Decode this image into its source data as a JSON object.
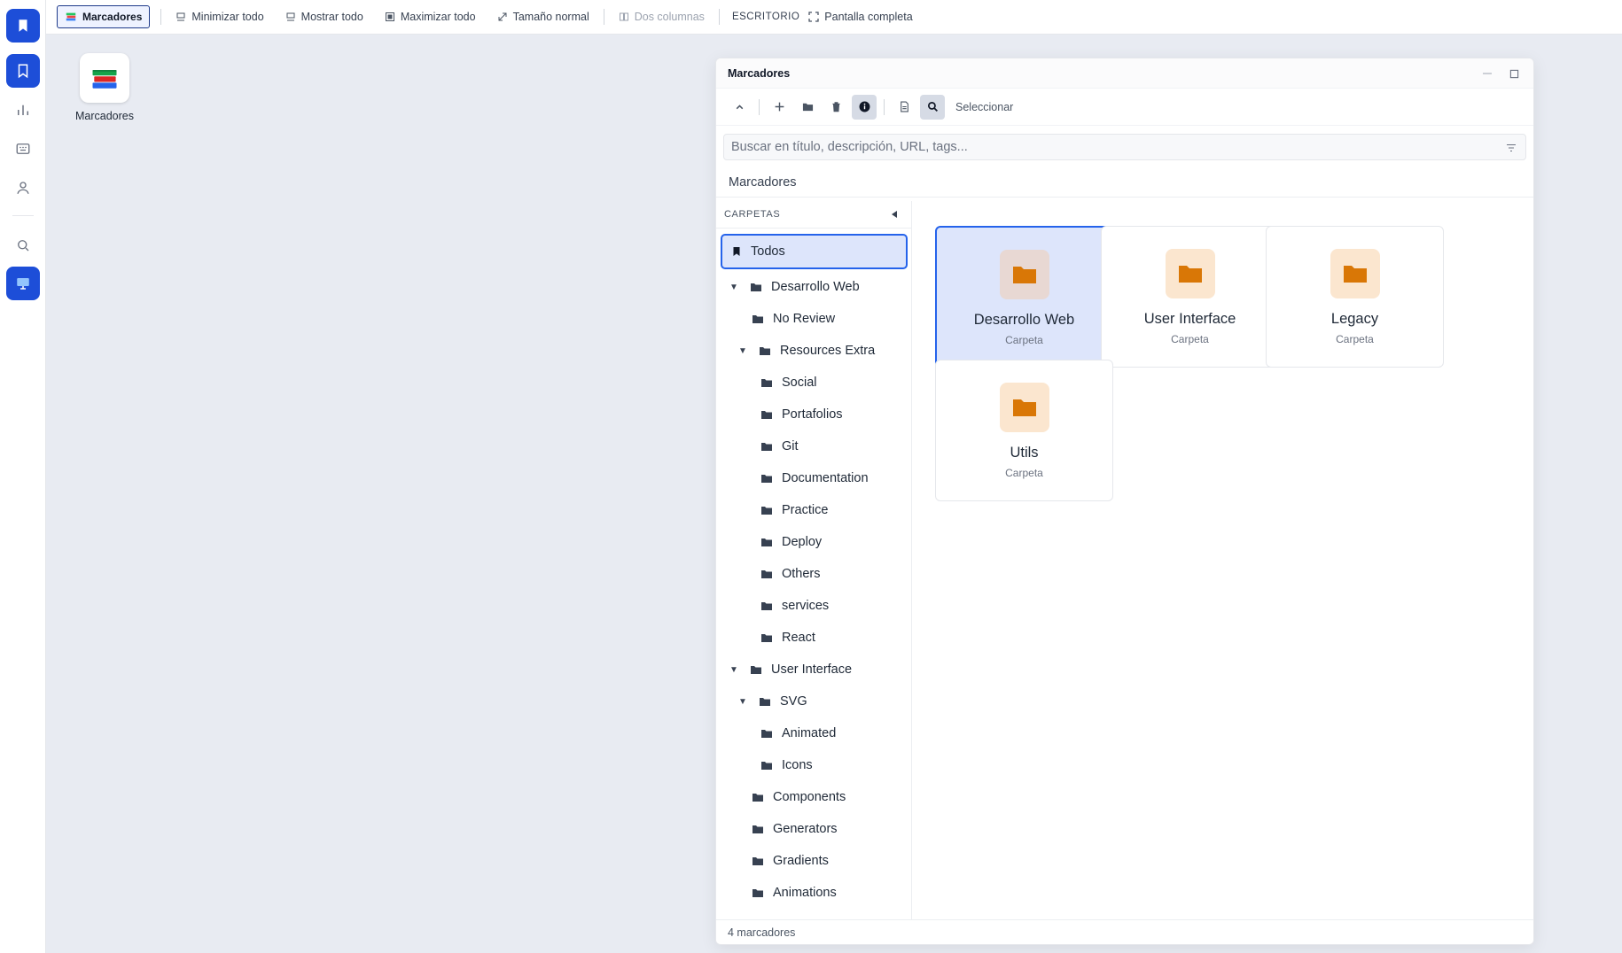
{
  "rail": {
    "items": [
      {
        "icon": "bookmark-icon",
        "active": true
      },
      {
        "icon": "bookmark-outline-icon",
        "active": true
      },
      {
        "icon": "bar-chart-icon",
        "active": false
      },
      {
        "icon": "keyboard-icon",
        "active": false
      },
      {
        "icon": "user-icon",
        "active": false
      },
      {
        "icon": "search-icon",
        "active": false
      },
      {
        "icon": "monitor-icon",
        "active": true
      }
    ]
  },
  "topbar": {
    "app_label": "Marcadores",
    "minimize_all": "Minimizar todo",
    "show_all": "Mostrar todo",
    "maximize_all": "Maximizar todo",
    "normal_size": "Tamaño normal",
    "two_columns": "Dos columnas",
    "desktop_label": "ESCRITORIO",
    "fullscreen": "Pantalla completa"
  },
  "desktop": {
    "icon_label": "Marcadores"
  },
  "window": {
    "title": "Marcadores",
    "toolbar": {
      "select_label": "Seleccionar"
    },
    "search": {
      "placeholder": "Buscar en título, descripción, URL, tags..."
    },
    "breadcrumb": "Marcadores",
    "sidebar": {
      "header": "CARPETAS",
      "tree": [
        {
          "label": "Todos",
          "depth": 0,
          "type": "all",
          "selected": true
        },
        {
          "label": "Desarrollo Web",
          "depth": 0,
          "type": "folder",
          "expanded": true
        },
        {
          "label": "No Review",
          "depth": 1,
          "type": "folder"
        },
        {
          "label": "Resources Extra",
          "depth": 1,
          "type": "folder",
          "expanded": true
        },
        {
          "label": "Social",
          "depth": 2,
          "type": "folder"
        },
        {
          "label": "Portafolios",
          "depth": 2,
          "type": "folder"
        },
        {
          "label": "Git",
          "depth": 2,
          "type": "folder"
        },
        {
          "label": "Documentation",
          "depth": 2,
          "type": "folder"
        },
        {
          "label": "Practice",
          "depth": 2,
          "type": "folder"
        },
        {
          "label": "Deploy",
          "depth": 2,
          "type": "folder"
        },
        {
          "label": "Others",
          "depth": 2,
          "type": "folder"
        },
        {
          "label": "services",
          "depth": 2,
          "type": "folder"
        },
        {
          "label": "React",
          "depth": 2,
          "type": "folder"
        },
        {
          "label": "User Interface",
          "depth": 0,
          "type": "folder",
          "expanded": true
        },
        {
          "label": "SVG",
          "depth": 1,
          "type": "folder",
          "expanded": true
        },
        {
          "label": "Animated",
          "depth": 2,
          "type": "folder"
        },
        {
          "label": "Icons",
          "depth": 2,
          "type": "folder"
        },
        {
          "label": "Components",
          "depth": 1,
          "type": "folder"
        },
        {
          "label": "Generators",
          "depth": 1,
          "type": "folder"
        },
        {
          "label": "Gradients",
          "depth": 1,
          "type": "folder"
        },
        {
          "label": "Animations",
          "depth": 1,
          "type": "folder"
        }
      ]
    },
    "cards": [
      {
        "name": "Desarrollo Web",
        "type": "Carpeta",
        "selected": true
      },
      {
        "name": "User Interface",
        "type": "Carpeta",
        "selected": false
      },
      {
        "name": "Legacy",
        "type": "Carpeta",
        "selected": false
      },
      {
        "name": "Utils",
        "type": "Carpeta",
        "selected": false
      }
    ],
    "status": "4 marcadores"
  },
  "colors": {
    "accent": "#2563eb",
    "rail_active": "#1d4ed8",
    "folder_orange": "#d97706"
  }
}
